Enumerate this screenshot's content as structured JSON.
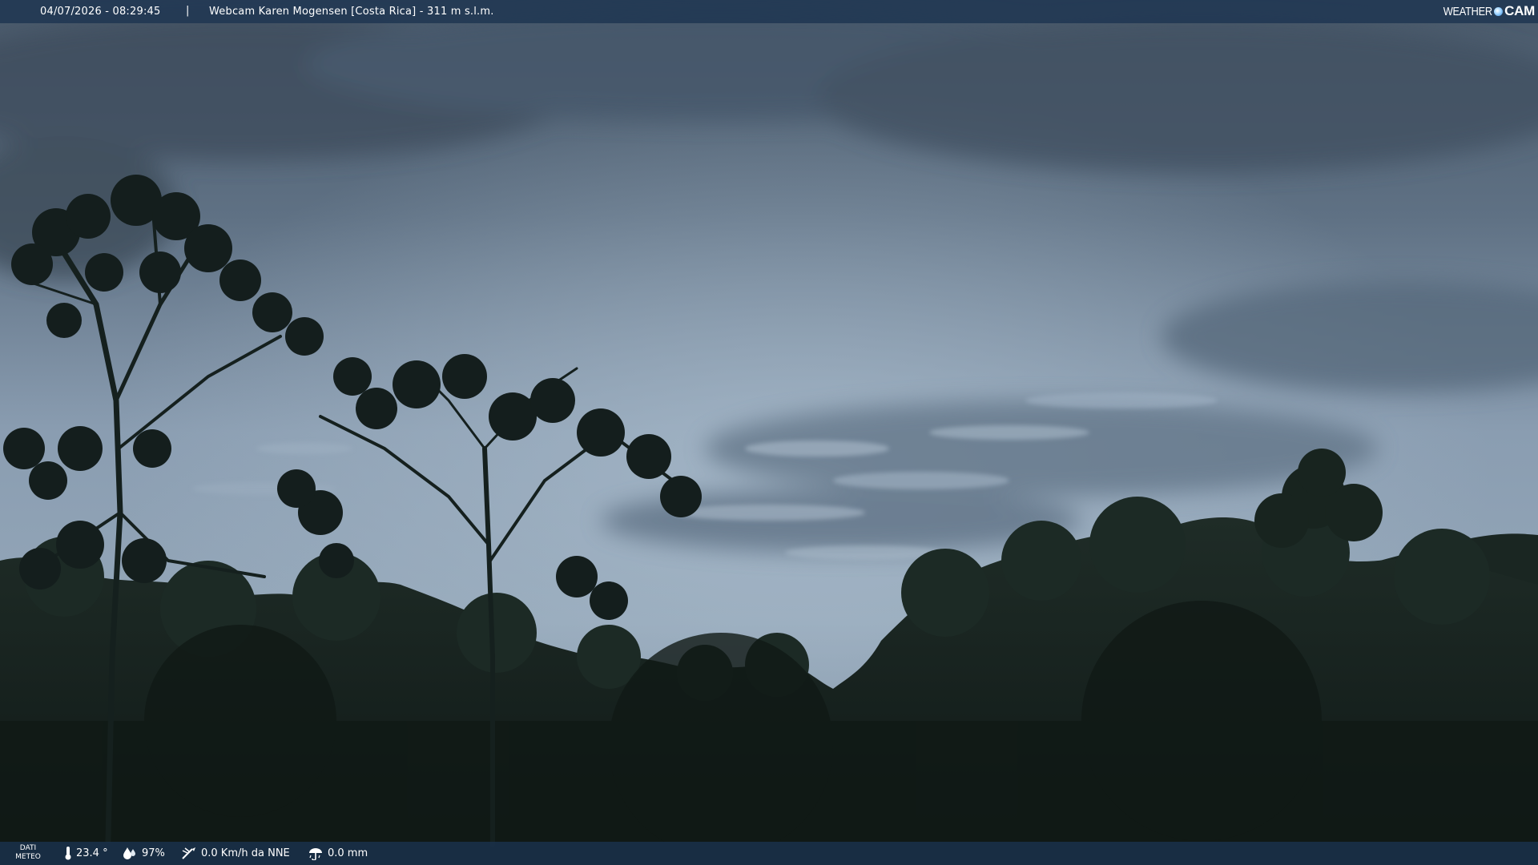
{
  "header": {
    "datetime": "04/07/2026 - 08:29:45",
    "separator": "|",
    "camera_title": "Webcam Karen Mogensen [Costa Rica]  - 311 m s.l.m.",
    "logo_left": "WEATHER",
    "logo_right": "CAM"
  },
  "footer": {
    "label_line1": "DATI",
    "label_line2": "METEO",
    "temperature": "23.4 °",
    "humidity": "97%",
    "wind": "0.0 Km/h da NNE",
    "rain": "0.0 mm"
  },
  "icons": {
    "temperature": "thermometer-icon",
    "humidity": "humidity-drop-icon",
    "wind": "wind-icon",
    "rain": "rain-gauge-icon",
    "logo": "weathercam-logo-icon"
  },
  "colors": {
    "bar_background": "#203752",
    "sky_top": "#4d5d6e",
    "sky_mid": "#8ea2b6",
    "forest": "#121c1a"
  }
}
